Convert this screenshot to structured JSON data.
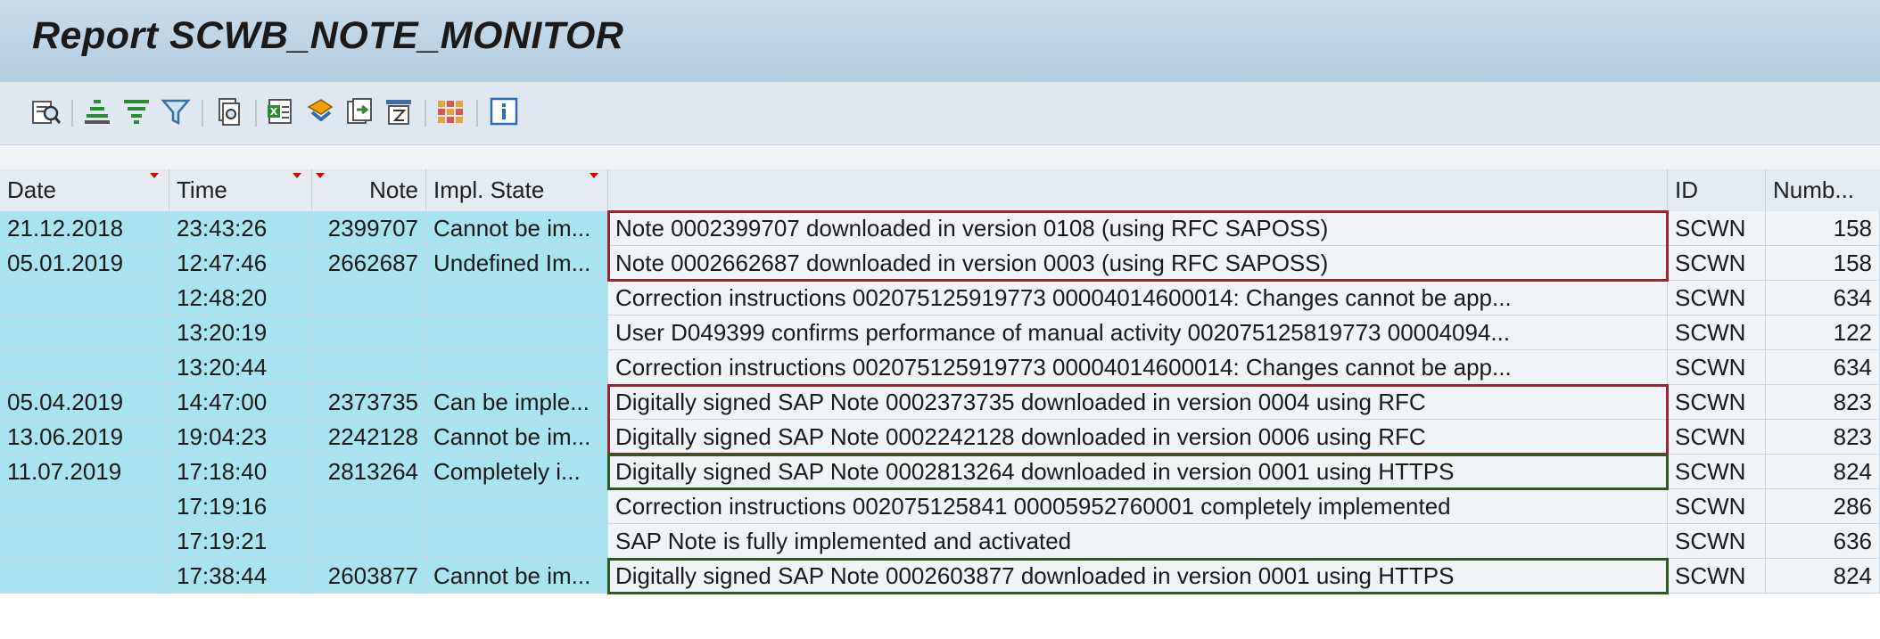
{
  "report": {
    "title": "Report SCWB_NOTE_MONITOR"
  },
  "toolbar": {
    "buttons": [
      {
        "icon": "details-icon"
      },
      {
        "icon": "sort-ascending-icon"
      },
      {
        "icon": "sort-descending-icon"
      },
      {
        "icon": "filter-icon"
      },
      {
        "icon": "print-preview-icon"
      },
      {
        "icon": "export-spreadsheet-icon"
      },
      {
        "icon": "export-local-file-icon"
      },
      {
        "icon": "send-icon"
      },
      {
        "icon": "abc-analysis-icon"
      },
      {
        "icon": "change-layout-icon"
      },
      {
        "icon": "information-icon"
      }
    ]
  },
  "table": {
    "columns": [
      "Date",
      "Time",
      "Note",
      "Impl. State",
      "",
      "ID",
      "Numb..."
    ],
    "rows": [
      {
        "date": "21.12.2018",
        "time": "23:43:26",
        "note": "2399707",
        "state": "Cannot be im...",
        "msg": "Note 0002399707 downloaded in version 0108 (using RFC SAPOSS)",
        "id": "SCWN",
        "num": "158"
      },
      {
        "date": "05.01.2019",
        "time": "12:47:46",
        "note": "2662687",
        "state": "Undefined Im...",
        "msg": "Note 0002662687 downloaded in version 0003 (using RFC SAPOSS)",
        "id": "SCWN",
        "num": "158"
      },
      {
        "date": "",
        "time": "12:48:20",
        "note": "",
        "state": "",
        "msg": "Correction instructions 002075125919773      00004014600014: Changes cannot be app...",
        "id": "SCWN",
        "num": "634"
      },
      {
        "date": "",
        "time": "13:20:19",
        "note": "",
        "state": "",
        "msg": "User D049399 confirms performance of manual activity 002075125819773      00004094...",
        "id": "SCWN",
        "num": "122"
      },
      {
        "date": "",
        "time": "13:20:44",
        "note": "",
        "state": "",
        "msg": "Correction instructions 002075125919773      00004014600014: Changes cannot be app...",
        "id": "SCWN",
        "num": "634"
      },
      {
        "date": "05.04.2019",
        "time": "14:47:00",
        "note": "2373735",
        "state": "Can be imple...",
        "msg": "Digitally signed SAP Note 0002373735 downloaded in version 0004 using RFC",
        "id": "SCWN",
        "num": "823"
      },
      {
        "date": "13.06.2019",
        "time": "19:04:23",
        "note": "2242128",
        "state": "Cannot be im...",
        "msg": "Digitally signed SAP Note 0002242128 downloaded in version 0006 using RFC",
        "id": "SCWN",
        "num": "823"
      },
      {
        "date": "11.07.2019",
        "time": "17:18:40",
        "note": "2813264",
        "state": "Completely i...",
        "msg": "Digitally signed SAP Note 0002813264 downloaded in version 0001 using HTTPS",
        "id": "SCWN",
        "num": "824"
      },
      {
        "date": "",
        "time": "17:19:16",
        "note": "",
        "state": "",
        "msg": "Correction instructions 002075125841          00005952760001 completely implemented",
        "id": "SCWN",
        "num": "286"
      },
      {
        "date": "",
        "time": "17:19:21",
        "note": "",
        "state": "",
        "msg": "SAP Note is fully implemented and activated",
        "id": "SCWN",
        "num": "636"
      },
      {
        "date": "",
        "time": "17:38:44",
        "note": "2603877",
        "state": "Cannot be im...",
        "msg": "Digitally signed SAP Note 0002603877 downloaded in version 0001 using HTTPS",
        "id": "SCWN",
        "num": "824"
      }
    ]
  },
  "highlights": {
    "red_color": "#9b2535",
    "green_color": "#2e5a20"
  },
  "colors": {
    "key_cell_bg": "#a9e3ef",
    "data_cell_bg": "#f1f4f7",
    "title_bar_bg": "#bfd4e6"
  }
}
